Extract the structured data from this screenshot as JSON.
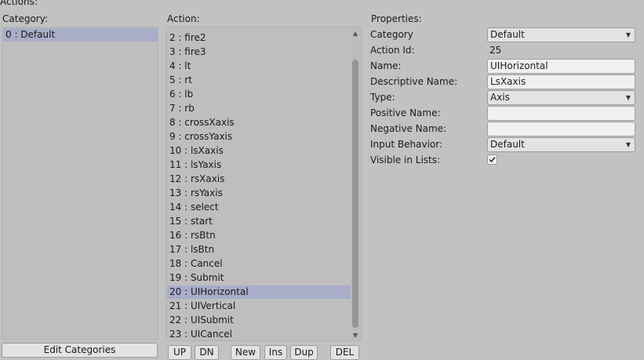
{
  "header": {
    "title": "Actions:"
  },
  "category": {
    "label": "Category:",
    "items": [
      "0 : Default"
    ],
    "edit_button": "Edit Categories"
  },
  "action": {
    "label": "Action:",
    "items": [
      "2 : fire2",
      "3 : fire3",
      "4 : lt",
      "5 : rt",
      "6 : lb",
      "7 : rb",
      "8 : crossXaxis",
      "9 : crossYaxis",
      "10 : lsXaxis",
      "11 : lsYaxis",
      "12 : rsXaxis",
      "13 : rsYaxis",
      "14 : select",
      "15 : start",
      "16 : rsBtn",
      "17 : lsBtn",
      "18 : Cancel",
      "19 : Submit",
      "20 : UIHorizontal",
      "21 : UIVertical",
      "22 : UISubmit",
      "23 : UICancel"
    ],
    "selected_index": 18,
    "buttons": {
      "up": "UP",
      "dn": "DN",
      "new": "New",
      "ins": "Ins",
      "dup": "Dup",
      "del": "DEL"
    }
  },
  "properties": {
    "label": "Properties:",
    "category_label": "Category",
    "category_value": "Default",
    "action_id_label": "Action Id:",
    "action_id_value": "25",
    "name_label": "Name:",
    "name_value": "UIHorizontal",
    "descriptive_name_label": "Descriptive Name:",
    "descriptive_name_value": "LsXaxis",
    "type_label": "Type:",
    "type_value": "Axis",
    "positive_name_label": "Positive Name:",
    "positive_name_value": "",
    "negative_name_label": "Negative Name:",
    "negative_name_value": "",
    "input_behavior_label": "Input Behavior:",
    "input_behavior_value": "Default",
    "visible_in_lists_label": "Visible in Lists:",
    "visible_in_lists_checked": true
  },
  "icons": {
    "dropdown_caret": "chevron-down-icon",
    "checkmark": "checkmark-icon",
    "scroll_up": "arrow-up-icon",
    "scroll_down": "arrow-down-icon"
  }
}
